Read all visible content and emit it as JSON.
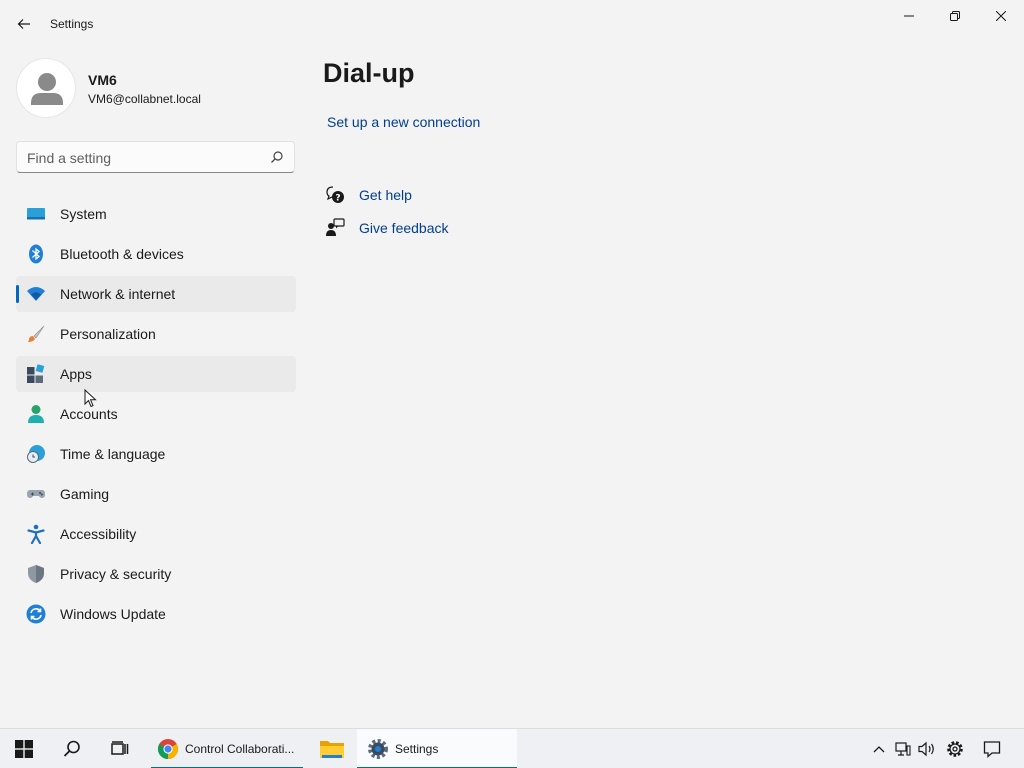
{
  "window": {
    "title": "Settings"
  },
  "profile": {
    "name": "VM6",
    "email": "VM6@collabnet.local"
  },
  "search": {
    "placeholder": "Find a setting"
  },
  "nav": {
    "items": [
      {
        "label": "System"
      },
      {
        "label": "Bluetooth & devices"
      },
      {
        "label": "Network & internet"
      },
      {
        "label": "Personalization"
      },
      {
        "label": "Apps"
      },
      {
        "label": "Accounts"
      },
      {
        "label": "Time & language"
      },
      {
        "label": "Gaming"
      },
      {
        "label": "Accessibility"
      },
      {
        "label": "Privacy & security"
      },
      {
        "label": "Windows Update"
      }
    ],
    "selected": "Network & internet"
  },
  "content": {
    "title": "Dial-up",
    "setup_link": "Set up a new connection",
    "help_label": "Get help",
    "feedback_label": "Give feedback"
  },
  "taskbar": {
    "chrome_label": "Control Collaborati...",
    "settings_label": "Settings"
  },
  "colors": {
    "accent": "#0067c0",
    "link": "#003e92",
    "background": "#f3f3f3"
  }
}
